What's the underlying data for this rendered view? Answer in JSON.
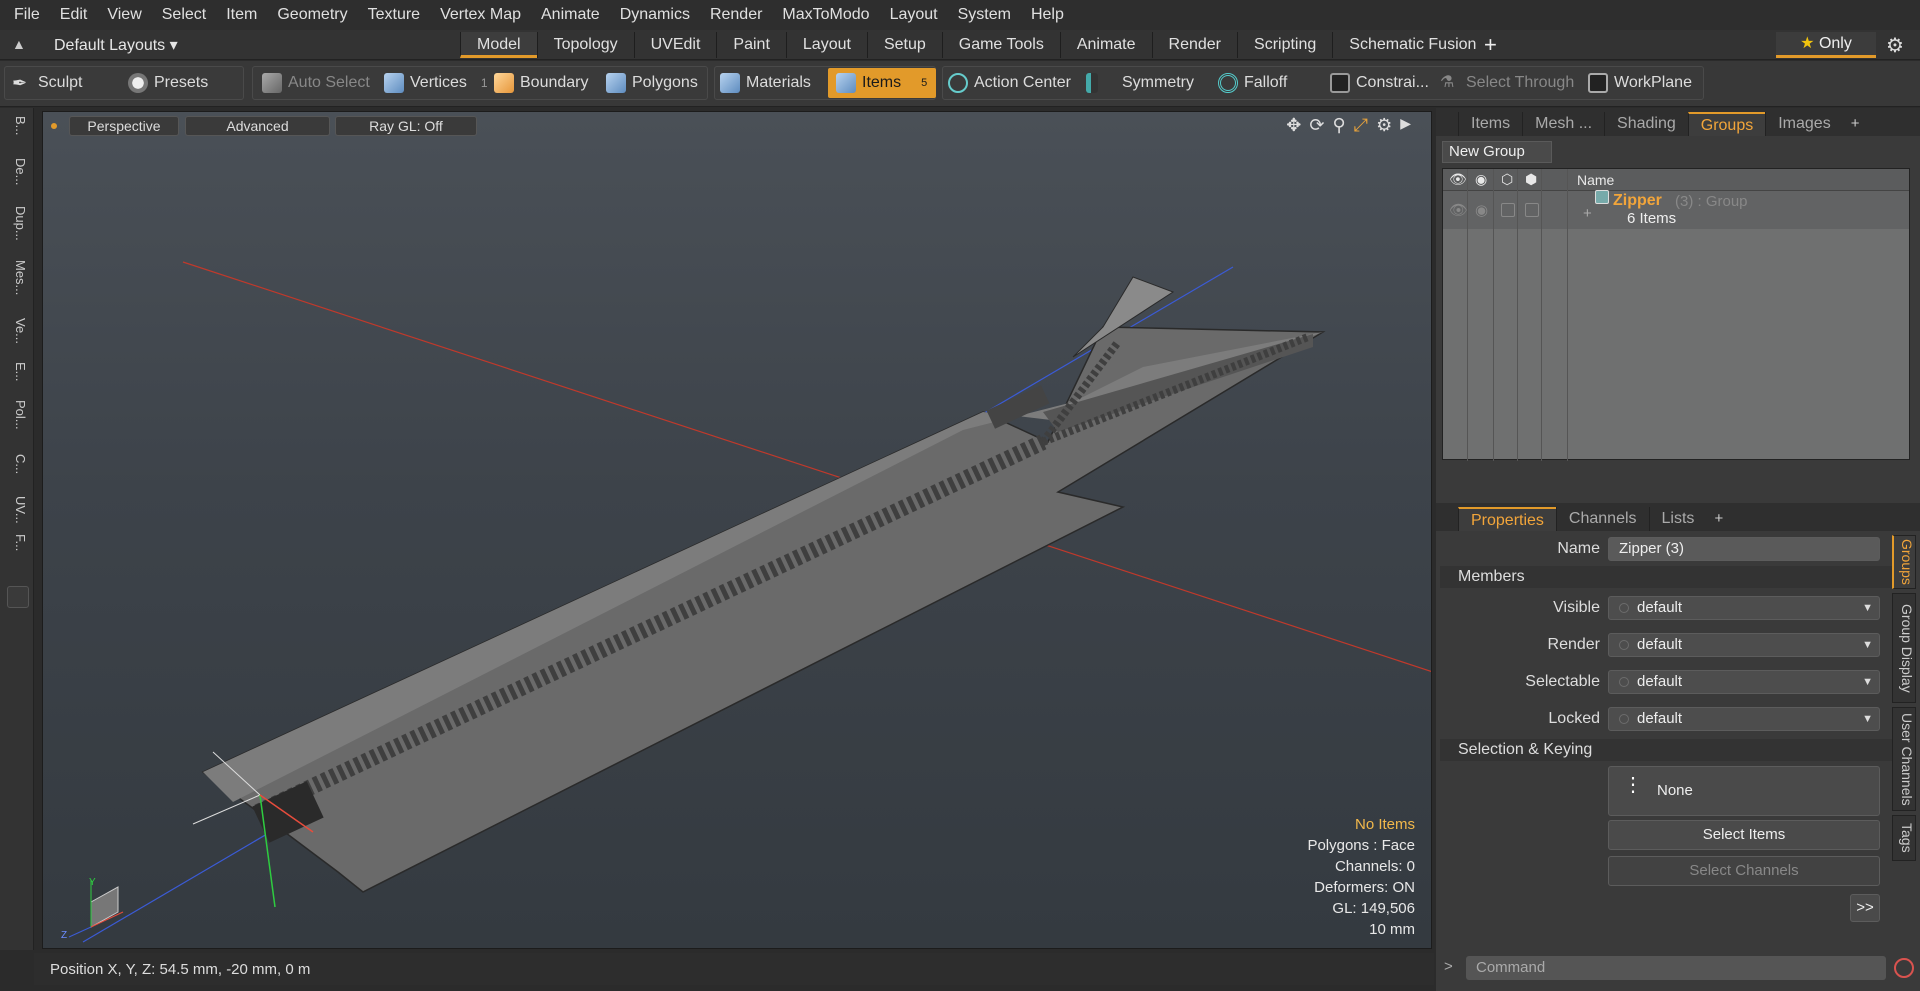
{
  "menu": [
    "File",
    "Edit",
    "View",
    "Select",
    "Item",
    "Geometry",
    "Texture",
    "Vertex Map",
    "Animate",
    "Dynamics",
    "Render",
    "MaxToModo",
    "Layout",
    "System",
    "Help"
  ],
  "layout_dropdown": "Default Layouts ▾",
  "layout_tabs": [
    {
      "label": "Model",
      "active": true
    },
    {
      "label": "Topology"
    },
    {
      "label": "UVEdit"
    },
    {
      "label": "Paint"
    },
    {
      "label": "Layout"
    },
    {
      "label": "Setup"
    },
    {
      "label": "Game Tools"
    },
    {
      "label": "Animate"
    },
    {
      "label": "Render"
    },
    {
      "label": "Scripting"
    },
    {
      "label": "Schematic Fusion"
    }
  ],
  "tab_plus": "+",
  "only_label": "Only",
  "toolbar": {
    "sculpt": "Sculpt",
    "presets": "Presets",
    "auto_select": "Auto Select",
    "vertices": "Vertices",
    "vertices_count": "1",
    "boundary": "Boundary",
    "polygons": "Polygons",
    "materials": "Materials",
    "items": "Items",
    "items_count": "5",
    "action_center": "Action Center",
    "symmetry": "Symmetry",
    "falloff": "Falloff",
    "constraints": "Constrai...",
    "select_through": "Select Through",
    "workplane": "WorkPlane"
  },
  "left_tabs": [
    "B...",
    "De...",
    "Dup...",
    "Mes...",
    "Ve...",
    "E...",
    "Pol...",
    "C...",
    "UV...",
    "F..."
  ],
  "viewport": {
    "view": "Perspective",
    "advanced": "Advanced",
    "raygl": "Ray GL: Off",
    "info": {
      "no_items": "No Items",
      "polygons": "Polygons : Face",
      "channels": "Channels: 0",
      "deformers": "Deformers: ON",
      "gl": "GL: 149,506",
      "scale": "10 mm"
    },
    "axis_y": "Y",
    "axis_z": "Z"
  },
  "status": {
    "position": "Position X, Y, Z:   54.5 mm, -20 mm, 0 m"
  },
  "right_top_tabs": [
    {
      "label": "Items"
    },
    {
      "label": "Mesh ..."
    },
    {
      "label": "Shading"
    },
    {
      "label": "Groups",
      "active": true
    },
    {
      "label": "Images"
    }
  ],
  "new_group": "New Group",
  "groups_header_name": "Name",
  "group_row": {
    "name": "Zipper",
    "suffix": "(3) : Group",
    "items": "6 Items"
  },
  "prop_tabs": [
    {
      "label": "Properties",
      "active": true
    },
    {
      "label": "Channels"
    },
    {
      "label": "Lists"
    }
  ],
  "props": {
    "name_label": "Name",
    "name_value": "Zipper (3)",
    "members": "Members",
    "visible_label": "Visible",
    "visible_value": "default",
    "render_label": "Render",
    "render_value": "default",
    "selectable_label": "Selectable",
    "selectable_value": "default",
    "locked_label": "Locked",
    "locked_value": "default",
    "selection_keying": "Selection & Keying",
    "none": "None",
    "select_items": "Select Items",
    "select_channels": "Select Channels",
    "more": ">>"
  },
  "right_vtabs": [
    {
      "label": "Groups",
      "active": true
    },
    {
      "label": "Group Display"
    },
    {
      "label": "User Channels"
    },
    {
      "label": "Tags"
    }
  ],
  "command_placeholder": "Command"
}
